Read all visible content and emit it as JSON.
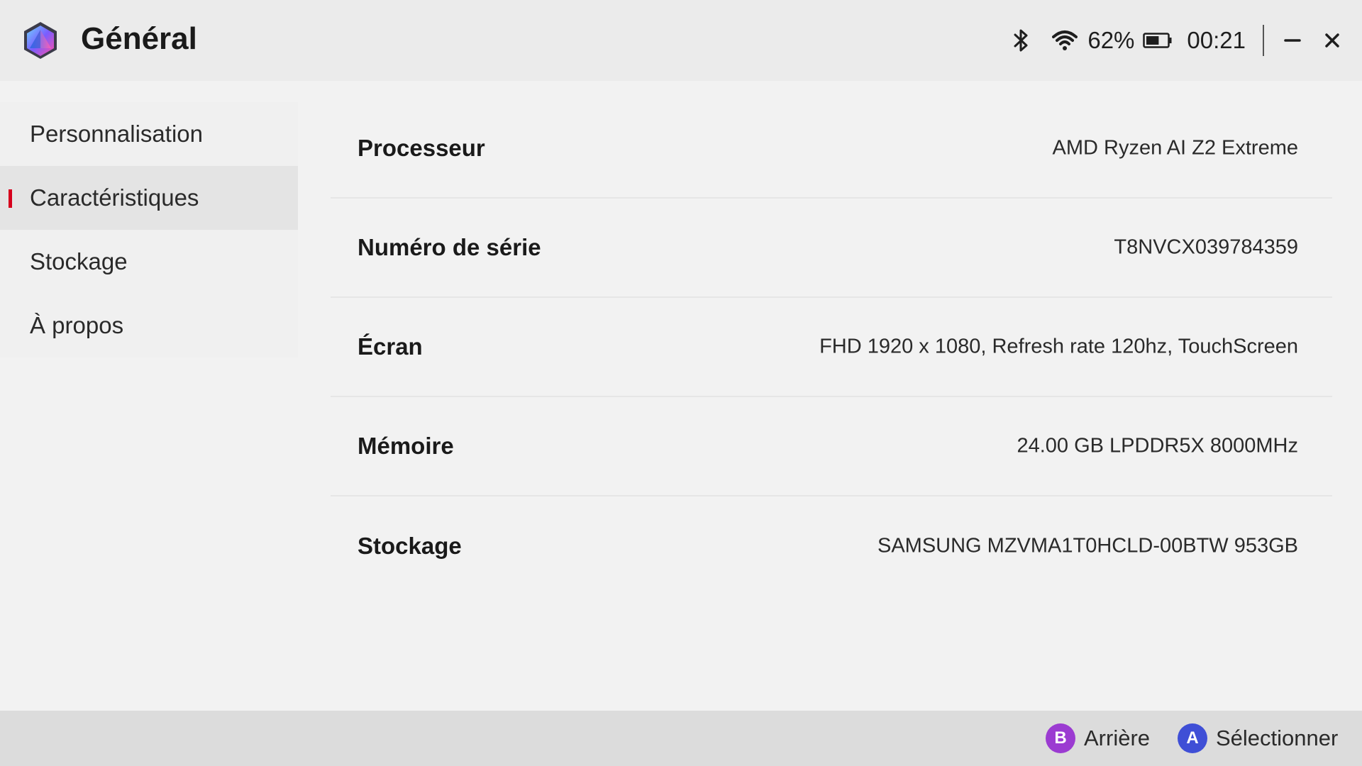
{
  "header": {
    "title": "Général",
    "logo_icon": "hexagon-logo-icon",
    "status": {
      "bluetooth_icon": "bluetooth-icon",
      "wifi_icon": "wifi-icon",
      "battery_percent": "62%",
      "battery_level": 0.62,
      "battery_icon": "battery-icon",
      "time": "00:21"
    },
    "window_controls": {
      "minimize_icon": "minimize-icon",
      "close_icon": "close-icon"
    }
  },
  "sidebar": {
    "items": [
      {
        "label": "Personnalisation",
        "active": false
      },
      {
        "label": "Caractéristiques",
        "active": true
      },
      {
        "label": "Stockage",
        "active": false
      },
      {
        "label": "À propos",
        "active": false
      }
    ]
  },
  "specs": {
    "rows": [
      {
        "label": "Processeur",
        "value": "AMD Ryzen AI Z2 Extreme"
      },
      {
        "label": "Numéro de série",
        "value": "T8NVCX039784359"
      },
      {
        "label": "Écran",
        "value": "FHD 1920 x 1080, Refresh rate 120hz, TouchScreen"
      },
      {
        "label": "Mémoire",
        "value": "24.00 GB LPDDR5X 8000MHz"
      },
      {
        "label": "Stockage",
        "value": "SAMSUNG MZVMA1T0HCLD-00BTW 953GB"
      }
    ]
  },
  "footer": {
    "back": {
      "button": "B",
      "label": "Arrière"
    },
    "select": {
      "button": "A",
      "label": "Sélectionner"
    }
  },
  "colors": {
    "accent_indicator": "#d6001c",
    "button_b": "#9b3bd1",
    "button_a": "#3f4fd6"
  }
}
